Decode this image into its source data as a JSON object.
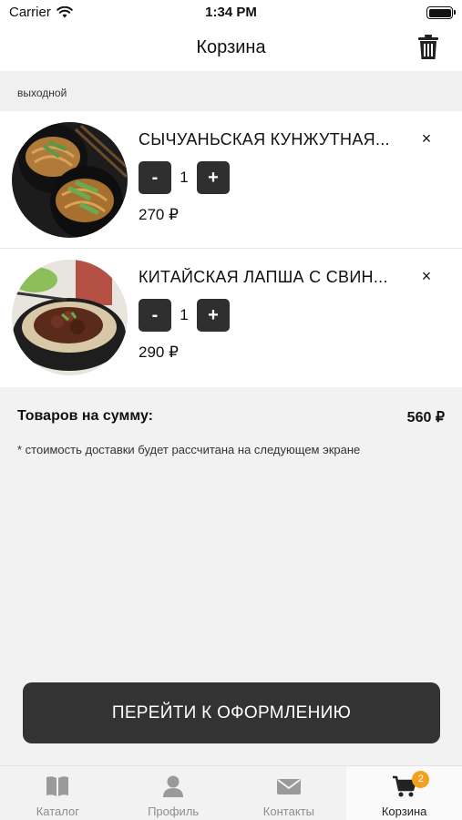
{
  "status_bar": {
    "carrier": "Carrier",
    "time": "1:34 PM"
  },
  "nav": {
    "title": "Корзина",
    "trash_icon": "trash-icon"
  },
  "section": {
    "label": "выходной"
  },
  "items": [
    {
      "name": "СЫЧУАНЬСКАЯ КУНЖУТНАЯ...",
      "quantity": "1",
      "price": "270 ₽",
      "minus": "-",
      "plus": "+",
      "remove": "×"
    },
    {
      "name": "КИТАЙСКАЯ ЛАПША С СВИН...",
      "quantity": "1",
      "price": "290 ₽",
      "minus": "-",
      "plus": "+",
      "remove": "×"
    }
  ],
  "summary": {
    "label": "Товаров на сумму:",
    "total": "560 ₽"
  },
  "note": "* стоимость доставки будет рассчитана на следующем экране",
  "checkout_label": "ПЕРЕЙТИ К ОФОРМЛЕНИЮ",
  "tabs": [
    {
      "label": "Каталог",
      "icon": "book-icon",
      "active": false
    },
    {
      "label": "Профиль",
      "icon": "person-icon",
      "active": false
    },
    {
      "label": "Контакты",
      "icon": "envelope-icon",
      "active": false
    },
    {
      "label": "Корзина",
      "icon": "cart-icon",
      "active": true,
      "badge": "2"
    }
  ],
  "colors": {
    "button": "#333333",
    "badge": "#f2a01e",
    "background": "#f2f2f2"
  }
}
